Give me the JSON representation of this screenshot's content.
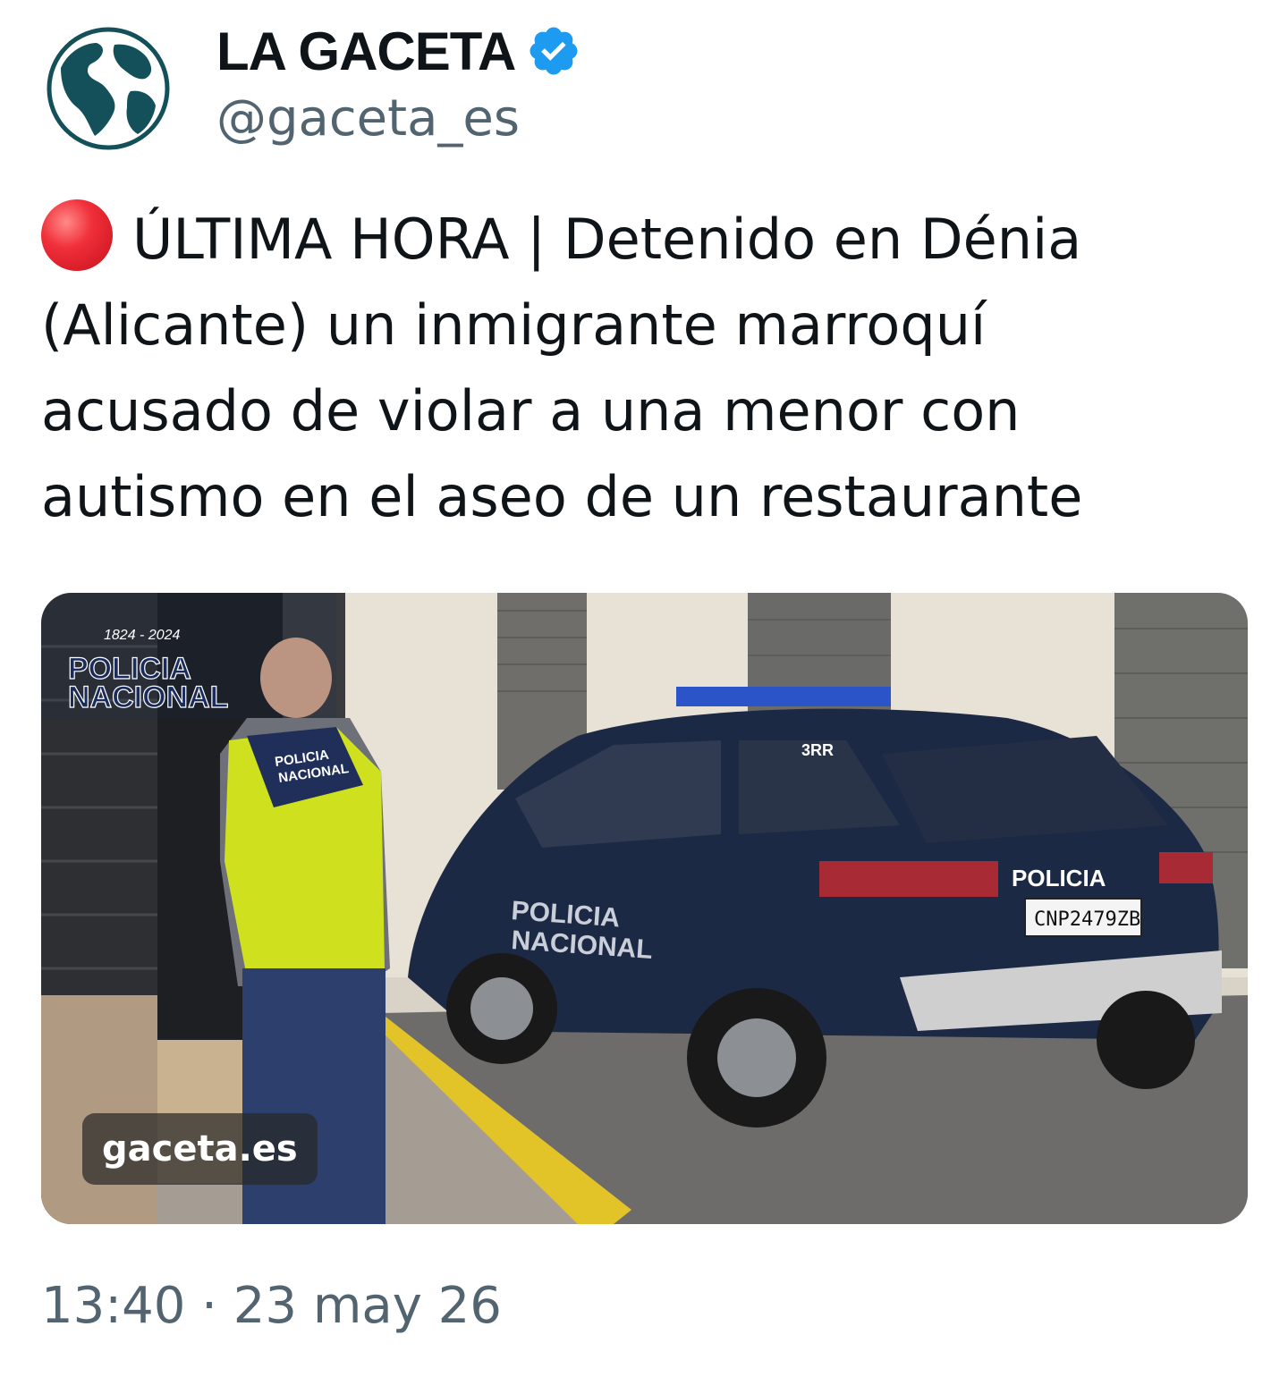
{
  "author": {
    "display_name": "LA GACETA",
    "handle": "@gaceta_es",
    "avatar_icon": "globe-icon",
    "verified_icon": "verified-badge-icon",
    "verified_color": "#1d9bf0"
  },
  "tweet": {
    "prefix_icon": "red-circle-icon",
    "text_lines": [
      "ÚLTIMA HORA | Detenido en Dénia",
      "(Alicante) un inmigrante marroquí",
      "acusado de violar a una menor con",
      "autismo en el aseo de un restaurante"
    ]
  },
  "media": {
    "logo_years": "1824 - 2024",
    "logo_line1": "POLICIA",
    "logo_line2": "NACIONAL",
    "vest_line1": "POLICIA",
    "vest_line2": "NACIONAL",
    "car_door_line1": "POLICIA",
    "car_door_line2": "NACIONAL",
    "car_rear_label": "POLICIA",
    "plate": "CNP2479ZB",
    "roof_code": "3RR",
    "watermark": "gaceta.es"
  },
  "timestamp": "13:40 · 23 may 26"
}
